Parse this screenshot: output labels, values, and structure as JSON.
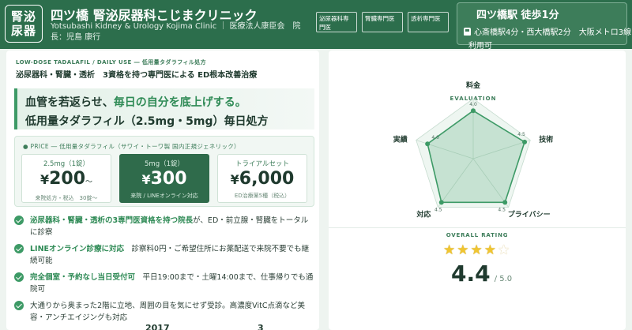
{
  "header": {
    "logo_line1": "腎泌",
    "logo_line2": "尿器",
    "clinic_name": "四ツ橋 腎泌尿器科こじまクリニック",
    "clinic_sub": "Yotsubashi Kidney & Urology Kojima Clinic ｜ 医療法人康臣会　院長：児島 康行",
    "tags": [
      "泌尿器科専門医",
      "腎臓専門医",
      "透析専門医"
    ]
  },
  "access": {
    "title": "四ツ橋駅 徒歩1分",
    "line1": "心斎橋駅4分・西大橋駅2分　大阪メトロ3線",
    "line2": "利用可",
    "train_icon": "train-icon"
  },
  "main": {
    "eyebrow": "LOW-DOSE TADALAFIL / DAILY USE ― 低用量タダラフィル処方",
    "subhead": "泌尿器科・腎臓・透析　3資格を持つ専門医による ED根本改善治療",
    "headline_pre": "血管を若返らせ、",
    "headline_highlight": "毎日の自分を底上げする。",
    "headline_line2": "低用量タダラフィル（2.5mg・5mg）毎日処方",
    "price_label": "● PRICE ― 低用量タダラフィル（サワイ・トーワ製 国内正規ジェネリック）",
    "prices": [
      {
        "title": "2.5mg（1錠）",
        "yen": "¥",
        "amount": "200",
        "suffix": "〜",
        "note": "来院処方・税込　30錠〜"
      },
      {
        "title": "5mg（1錠）",
        "yen": "¥",
        "amount": "300",
        "suffix": "",
        "note": "来院 / LINEオンライン対応"
      },
      {
        "title": "トライアルセット",
        "yen": "¥",
        "amount": "6,000",
        "suffix": "",
        "note": "ED治療薬5種（税込）"
      }
    ],
    "features": [
      {
        "strong": "泌尿器科・腎臓・透析の3専門医資格を持つ院長",
        "rest": "が、ED・前立腺・腎臓をトータルに診察"
      },
      {
        "strong": "LINEオンライン診療に対応",
        "rest": "　診察料0円・ご希望住所にお薬配送で来院不要でも継続可能"
      },
      {
        "strong": "完全個室・予約なし当日受付可",
        "rest": "　平日19:00まで・土曜14:00まで、仕事帰りでも通院可"
      },
      {
        "strong": "",
        "rest": "大通りから奥まった2階に立地、周囲の目を気にせず受診。高濃度VitC点滴など美容・アンチエイジングも対応"
      }
    ],
    "peek_stats": [
      "",
      "2017",
      "3"
    ]
  },
  "rating": {
    "evaluation_label": "EVALUATION",
    "overall_label": "OVERALL RATING",
    "score": "4.4",
    "score_max": "/ 5.0",
    "stars": [
      1,
      1,
      1,
      1,
      0.5
    ],
    "accent": "#3d9a66",
    "star_color": "#f0c531"
  },
  "chart_data": {
    "type": "radar",
    "axes": [
      "料金",
      "技術",
      "プライバシー",
      "対応",
      "実績"
    ],
    "values": [
      4.0,
      4.5,
      4.5,
      4.5,
      4.0
    ],
    "value_labels": [
      "4.0",
      "4.5",
      "4.5",
      "4.5",
      "4.0"
    ],
    "max": 5
  }
}
